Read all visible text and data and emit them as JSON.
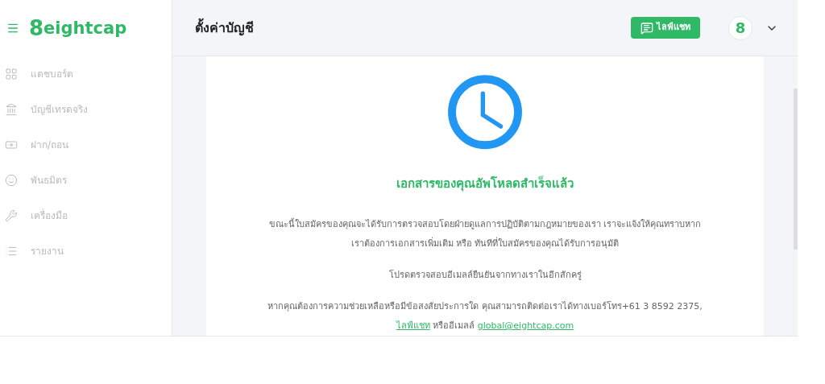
{
  "sidebar": {
    "logo": "eightcap",
    "logo_mark": "8",
    "items": [
      {
        "kind": "dashboard",
        "label": "แดชบอร์ด"
      },
      {
        "kind": "bank",
        "label": "บัญชีเทรดจริง"
      },
      {
        "kind": "money",
        "label": "ฝาก/ถอน"
      },
      {
        "kind": "partners",
        "label": "พันธมิตร"
      },
      {
        "kind": "tools",
        "label": "เครื่องมือ"
      },
      {
        "kind": "reports",
        "label": "รายงาน"
      }
    ]
  },
  "header": {
    "title": "ตั้งค่าบัญชี",
    "chat_button": "ไลฟ์แชท",
    "avatar": "8"
  },
  "card": {
    "heading": "เอกสารของคุณอัพโหลดสำเร็จแล้ว",
    "paragraphs": [
      "ขณะนี้ใบสมัครของคุณจะได้รับการตรวจสอบโดยฝ่ายดูแลการปฏิบัติตามกฎหมายของเรา เราจะแจ้งให้คุณทราบหากเราต้องการเอกสารเพิ่มเติม หรือ ทันทีที่ใบสมัครของคุณได้รับการอนุมัติ",
      "โปรดตรวจสอบอีเมลล์ยืนยันจากทางเราในอีกสักครู่"
    ],
    "contact": {
      "text_before": "หากคุณต้องการความช่วยเหลือหรือมีข้อสงสัยประการใด คุณสามารถติดต่อเราได้ทางเบอร์โทร+61 3 8592 2375,",
      "chat_link": "ไลฟ์แชท",
      "text_middle": "หรืออีเมลล์",
      "email_link": "global@eightcap.com"
    }
  }
}
